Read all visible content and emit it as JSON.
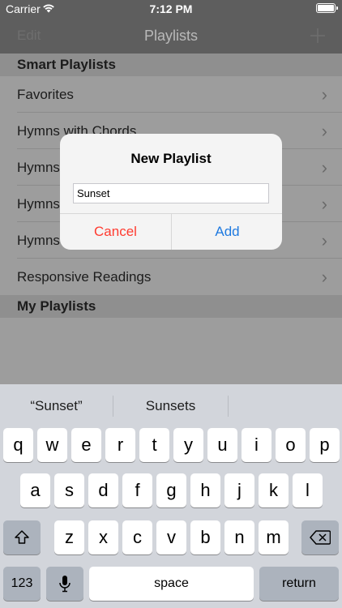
{
  "status_bar": {
    "carrier": "Carrier",
    "time": "7:12 PM"
  },
  "nav_bar": {
    "edit_label": "Edit",
    "title": "Playlists",
    "add_label": "+"
  },
  "list": {
    "smart_header": "Smart Playlists",
    "items": [
      {
        "label": "Favorites"
      },
      {
        "label": "Hymns with Chords"
      },
      {
        "label": "Hymns"
      },
      {
        "label": "Hymns"
      },
      {
        "label": "Hymns"
      },
      {
        "label": "Responsive Readings"
      }
    ],
    "my_header": "My Playlists"
  },
  "alert": {
    "title": "New Playlist",
    "field_value": "Sunset",
    "cancel_label": "Cancel",
    "add_label": "Add",
    "colors": {
      "cancel": "#ff3b30",
      "add": "#1f7ae0"
    }
  },
  "keyboard": {
    "suggestions": [
      "“Sunset”",
      "Sunsets",
      ""
    ],
    "row1": [
      "q",
      "w",
      "e",
      "r",
      "t",
      "y",
      "u",
      "i",
      "o",
      "p"
    ],
    "row2": [
      "a",
      "s",
      "d",
      "f",
      "g",
      "h",
      "j",
      "k",
      "l"
    ],
    "row3": [
      "z",
      "x",
      "c",
      "v",
      "b",
      "n",
      "m"
    ],
    "numbers_label": "123",
    "space_label": "space",
    "return_label": "return"
  }
}
